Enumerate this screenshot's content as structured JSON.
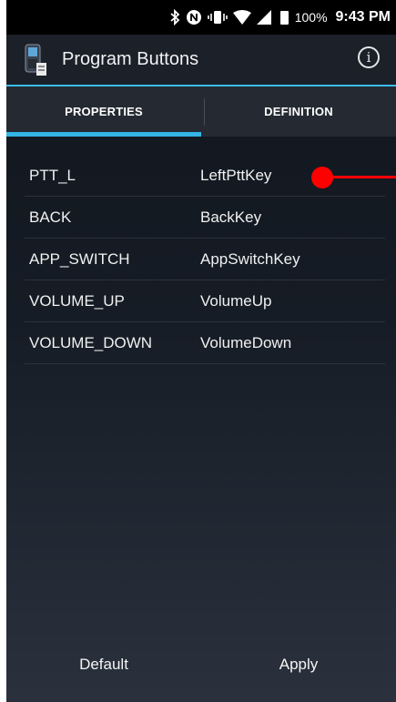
{
  "status_bar": {
    "icons": [
      "bluetooth-icon",
      "nfc-icon",
      "vibrate-icon",
      "wifi-icon",
      "signal-icon",
      "battery-icon"
    ],
    "battery_percent": "100%",
    "time": "9:43 PM"
  },
  "app_bar": {
    "title": "Program Buttons",
    "info_icon": "info-icon"
  },
  "tabs": [
    {
      "label": "PROPERTIES",
      "selected": true
    },
    {
      "label": "DEFINITION",
      "selected": false
    }
  ],
  "list": {
    "rows": [
      {
        "name": "PTT_L",
        "value": "LeftPttKey"
      },
      {
        "name": "BACK",
        "value": "BackKey"
      },
      {
        "name": "APP_SWITCH",
        "value": "AppSwitchKey"
      },
      {
        "name": "VOLUME_UP",
        "value": "VolumeUp"
      },
      {
        "name": "VOLUME_DOWN",
        "value": "VolumeDown"
      }
    ]
  },
  "buttons": {
    "default_label": "Default",
    "apply_label": "Apply"
  },
  "colors": {
    "accent": "#33b5e5",
    "annotation": "#ff0000"
  }
}
